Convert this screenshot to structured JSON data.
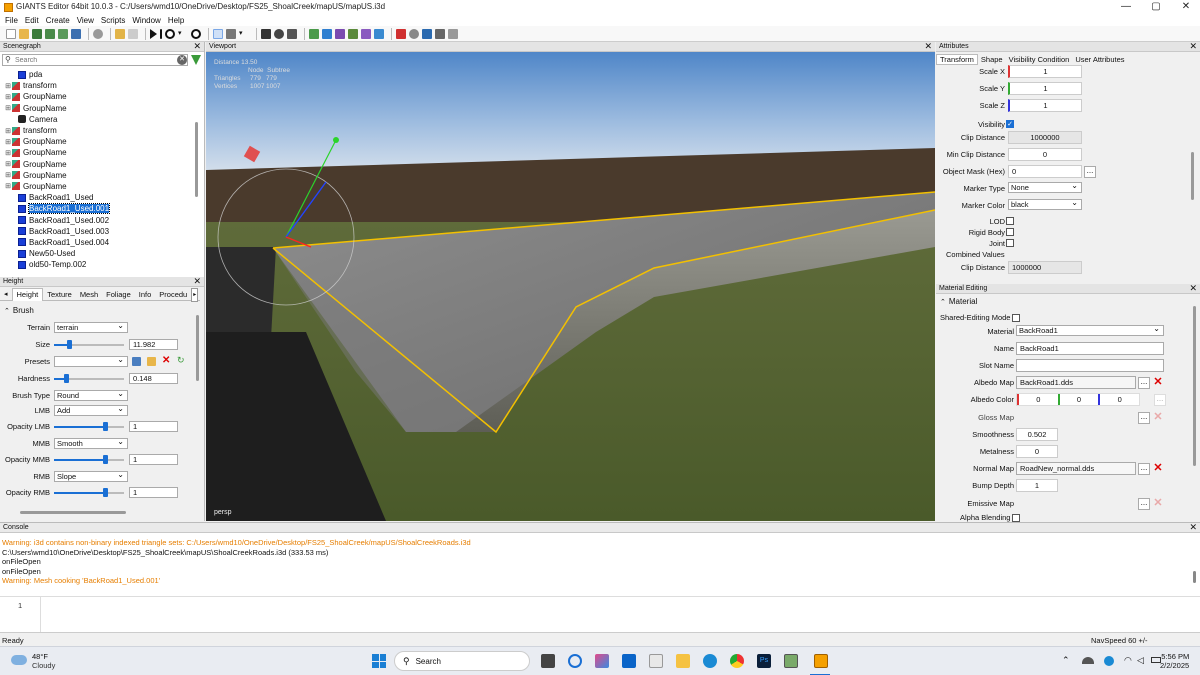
{
  "window": {
    "title": "GIANTS Editor 64bit 10.0.3 - C:/Users/wmd10/OneDrive/Desktop/FS25_ShoalCreek/mapUS/mapUS.i3d",
    "minimize": "—",
    "maximize": "▢",
    "close": "✕"
  },
  "menu": [
    "File",
    "Edit",
    "Create",
    "View",
    "Scripts",
    "Window",
    "Help"
  ],
  "scenegraph": {
    "title": "Scenegraph",
    "search_placeholder": "Search",
    "nodes": [
      {
        "label": "pda",
        "expander": "",
        "icon": "cube-icon",
        "selected": false,
        "indent": 1
      },
      {
        "label": "transform",
        "expander": "⊞",
        "icon": "group-icon",
        "selected": false,
        "indent": 0
      },
      {
        "label": "GroupName",
        "expander": "⊞",
        "icon": "group-icon",
        "selected": false,
        "indent": 0
      },
      {
        "label": "GroupName",
        "expander": "⊞",
        "icon": "group-icon",
        "selected": false,
        "indent": 0
      },
      {
        "label": "Camera",
        "expander": "",
        "icon": "camera-icon",
        "selected": false,
        "indent": 1
      },
      {
        "label": "transform",
        "expander": "⊞",
        "icon": "group-icon",
        "selected": false,
        "indent": 0
      },
      {
        "label": "GroupName",
        "expander": "⊞",
        "icon": "group-icon",
        "selected": false,
        "indent": 0
      },
      {
        "label": "GroupName",
        "expander": "⊞",
        "icon": "group-icon",
        "selected": false,
        "indent": 0
      },
      {
        "label": "GroupName",
        "expander": "⊞",
        "icon": "group-icon",
        "selected": false,
        "indent": 0
      },
      {
        "label": "GroupName",
        "expander": "⊞",
        "icon": "group-icon",
        "selected": false,
        "indent": 0
      },
      {
        "label": "GroupName",
        "expander": "⊞",
        "icon": "group-icon",
        "selected": false,
        "indent": 0
      },
      {
        "label": "BackRoad1_Used",
        "expander": "",
        "icon": "cube-icon",
        "selected": false,
        "indent": 1
      },
      {
        "label": "BackRoad1_Used.001",
        "expander": "",
        "icon": "cube-icon",
        "selected": true,
        "indent": 1
      },
      {
        "label": "BackRoad1_Used.002",
        "expander": "",
        "icon": "cube-icon",
        "selected": false,
        "indent": 1
      },
      {
        "label": "BackRoad1_Used.003",
        "expander": "",
        "icon": "cube-icon",
        "selected": false,
        "indent": 1
      },
      {
        "label": "BackRoad1_Used.004",
        "expander": "",
        "icon": "cube-icon",
        "selected": false,
        "indent": 1
      },
      {
        "label": "New50-Used",
        "expander": "",
        "icon": "cube-icon",
        "selected": false,
        "indent": 1
      },
      {
        "label": "old50-Temp.002",
        "expander": "",
        "icon": "cube-icon",
        "selected": false,
        "indent": 1
      }
    ]
  },
  "height": {
    "title": "Height",
    "tabs": [
      "Height",
      "Texture",
      "Mesh",
      "Foliage",
      "Info",
      "Procedu"
    ],
    "section": "Brush",
    "terrain_label": "Terrain",
    "terrain_value": "terrain",
    "size_label": "Size",
    "size_value": "11.982",
    "size_fraction": 0.2,
    "presets_label": "Presets",
    "hardness_label": "Hardness",
    "hardness_value": "0.148",
    "hardness_fraction": 0.15,
    "brushtype_label": "Brush Type",
    "brushtype_value": "Round",
    "lmb_label": "LMB",
    "lmb_value": "Add",
    "opacity_lmb_label": "Opacity LMB",
    "opacity_lmb_value": "1",
    "mmb_label": "MMB",
    "mmb_value": "Smooth",
    "opacity_mmb_label": "Opacity MMB",
    "opacity_mmb_value": "1",
    "rmb_label": "RMB",
    "rmb_value": "Slope",
    "opacity_rmb_label": "Opacity RMB",
    "opacity_rmb_value": "1",
    "opacity_fraction": 1.0
  },
  "viewport": {
    "title": "Viewport",
    "distance": "Distance 13.50",
    "col_node": "Node",
    "col_subtree": "Subtree",
    "triangles_label": "Triangles",
    "triangles_node": "779",
    "triangles_subtree": "779",
    "vertices_label": "Vertices",
    "vertices_node": "1007",
    "vertices_subtree": "1007",
    "camera_mode": "persp"
  },
  "attributes": {
    "title": "Attributes",
    "tabs": [
      "Transform",
      "Shape",
      "Visibility Condition",
      "User Attributes"
    ],
    "scale_x_label": "Scale X",
    "scale_x": "1",
    "scale_y_label": "Scale Y",
    "scale_y": "1",
    "scale_z_label": "Scale Z",
    "scale_z": "1",
    "visibility_label": "Visibility",
    "clip_label": "Clip Distance",
    "clip_value": "1000000",
    "minclip_label": "Min Clip Distance",
    "minclip_value": "0",
    "mask_label": "Object Mask (Hex)",
    "mask_value": "0",
    "marker_type_label": "Marker Type",
    "marker_type": "None",
    "marker_color_label": "Marker Color",
    "marker_color": "black",
    "lod_label": "LOD",
    "rigid_label": "Rigid Body",
    "joint_label": "Joint",
    "combined_label": "Combined Values",
    "combined_clip_label": "Clip Distance",
    "combined_clip_value": "1000000"
  },
  "material": {
    "title": "Material Editing",
    "section": "Material",
    "shared_label": "Shared-Editing Mode",
    "material_label": "Material",
    "material_value": "BackRoad1",
    "name_label": "Name",
    "name_value": "BackRoad1",
    "slot_label": "Slot Name",
    "slot_value": "",
    "albedo_map_label": "Albedo Map",
    "albedo_map_value": "BackRoad1.dds",
    "albedo_color_label": "Albedo Color",
    "albedo_r": "0",
    "albedo_g": "0",
    "albedo_b": "0",
    "gloss_label": "Gloss Map",
    "smooth_label": "Smoothness",
    "smooth_value": "0.502",
    "metal_label": "Metalness",
    "metal_value": "0",
    "normal_label": "Normal Map",
    "normal_value": "RoadNew_normal.dds",
    "bump_label": "Bump Depth",
    "bump_value": "1",
    "emissive_label": "Emissive Map",
    "alpha_label": "Alpha Blending",
    "dots": "...",
    "x": "✕"
  },
  "console": {
    "title": "Console",
    "lines": [
      {
        "text": "Warning: i3d contains non-binary indexed triangle sets: C:/Users/wmd10/OneDrive/Desktop/FS25_ShoalCreek/mapUS/ShoalCreekRoads.i3d",
        "warn": true
      },
      {
        "text": "C:\\Users\\wmd10\\OneDrive\\Desktop\\FS25_ShoalCreek\\mapUS\\ShoalCreekRoads.i3d (333.53 ms)",
        "warn": false
      },
      {
        "text": "onFileOpen",
        "warn": false
      },
      {
        "text": "onFileOpen",
        "warn": false
      },
      {
        "text": "Warning: Mesh cooking 'BackRoad1_Used.001'",
        "warn": true
      }
    ],
    "input_line_number": "1"
  },
  "status": {
    "left": "Ready",
    "navspeed": "NavSpeed 60 +/-"
  },
  "taskbar": {
    "weather_temp": "48°F",
    "weather_desc": "Cloudy",
    "search_label": "Search",
    "time": "5:56 PM",
    "date": "2/2/2025"
  },
  "colors": {
    "accent": "#1a6fd4",
    "warning": "#e67e00",
    "selection_outline": "#f3c000"
  }
}
